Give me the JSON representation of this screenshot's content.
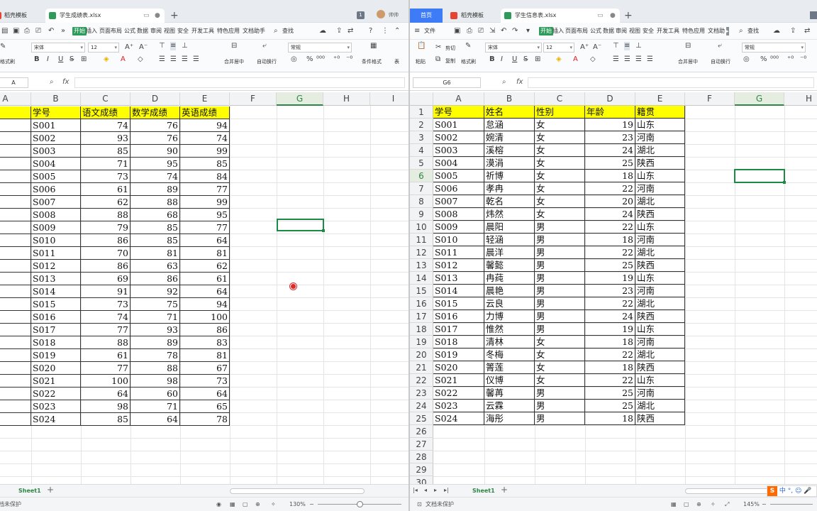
{
  "left": {
    "tabs": [
      {
        "label": "稻壳模板",
        "active": false
      },
      {
        "label": "学生成绩表.xlsx",
        "active": true
      }
    ],
    "tab_count": "1",
    "user": "帅帅",
    "menu": [
      "开始",
      "插入",
      "页面布局",
      "公式",
      "数据",
      "审阅",
      "视图",
      "安全",
      "开发工具",
      "特色应用",
      "文档助手"
    ],
    "search": "查找",
    "ribbon": {
      "font": "宋体",
      "size": "12",
      "number_format": "常规",
      "format_painter": "格式刷",
      "merge": "合并居中",
      "wrap": "自动换行",
      "conditional": "条件格式",
      "table": "表"
    },
    "name_box": "A",
    "fx": "fx",
    "col_headers": [
      "A",
      "B",
      "C",
      "D",
      "E",
      "F",
      "G",
      "H",
      "I"
    ],
    "selected_col": "G",
    "header_row": [
      "学号",
      "语文成绩",
      "数学成绩",
      "英语成绩"
    ],
    "rows": [
      [
        "S001",
        74,
        76,
        94
      ],
      [
        "S002",
        93,
        76,
        74
      ],
      [
        "S003",
        85,
        90,
        99
      ],
      [
        "S004",
        71,
        95,
        85
      ],
      [
        "S005",
        73,
        74,
        84
      ],
      [
        "S006",
        61,
        89,
        77
      ],
      [
        "S007",
        62,
        88,
        99
      ],
      [
        "S008",
        88,
        68,
        95
      ],
      [
        "S009",
        79,
        85,
        77
      ],
      [
        "S010",
        86,
        85,
        64
      ],
      [
        "S011",
        70,
        81,
        81
      ],
      [
        "S012",
        86,
        63,
        62
      ],
      [
        "S013",
        69,
        86,
        61
      ],
      [
        "S014",
        91,
        92,
        64
      ],
      [
        "S015",
        73,
        75,
        94
      ],
      [
        "S016",
        74,
        71,
        100
      ],
      [
        "S017",
        77,
        93,
        86
      ],
      [
        "S018",
        88,
        89,
        83
      ],
      [
        "S019",
        61,
        78,
        81
      ],
      [
        "S020",
        77,
        88,
        67
      ],
      [
        "S021",
        100,
        98,
        73
      ],
      [
        "S022",
        64,
        60,
        64
      ],
      [
        "S023",
        98,
        71,
        65
      ],
      [
        "S024",
        85,
        64,
        78
      ]
    ],
    "sheet": "Sheet1",
    "status": "档未保护",
    "zoom": "130%"
  },
  "right": {
    "home": "首页",
    "tabs": [
      {
        "label": "稻壳模板",
        "active": false
      },
      {
        "label": "学生信息表.xlsx",
        "active": true
      }
    ],
    "file_menu": "文件",
    "menu": [
      "开始",
      "插入",
      "页面布局",
      "公式",
      "数据",
      "审阅",
      "视图",
      "安全",
      "开发工具",
      "特色应用",
      "文档助"
    ],
    "search": "查找",
    "ribbon": {
      "paste": "粘贴",
      "cut": "剪切",
      "copy": "复制",
      "format_painter": "格式刷",
      "font": "宋体",
      "size": "12",
      "number_format": "常规",
      "merge": "合并居中",
      "wrap": "自动换行",
      "conditional": "条件格式"
    },
    "name_box": "G6",
    "fx": "fx",
    "col_headers": [
      "A",
      "B",
      "C",
      "D",
      "E",
      "F",
      "G",
      "H"
    ],
    "selected_col": "G",
    "selected_row": 6,
    "row_numbers": [
      1,
      2,
      3,
      4,
      5,
      6,
      7,
      8,
      9,
      10,
      11,
      12,
      13,
      14,
      15,
      16,
      17,
      18,
      19,
      20,
      21,
      22,
      23,
      24,
      25,
      26,
      27,
      28,
      29,
      30
    ],
    "header_row": [
      "学号",
      "姓名",
      "性别",
      "年龄",
      "籍贯"
    ],
    "rows": [
      [
        "S001",
        "怠涵",
        "女",
        19,
        "山东"
      ],
      [
        "S002",
        "婉清",
        "女",
        23,
        "河南"
      ],
      [
        "S003",
        "溪榕",
        "女",
        24,
        "湖北"
      ],
      [
        "S004",
        "漠涓",
        "女",
        25,
        "陕西"
      ],
      [
        "S005",
        "祈博",
        "女",
        18,
        "山东"
      ],
      [
        "S006",
        "孝冉",
        "女",
        22,
        "河南"
      ],
      [
        "S007",
        "乾名",
        "女",
        20,
        "湖北"
      ],
      [
        "S008",
        "炜然",
        "女",
        24,
        "陕西"
      ],
      [
        "S009",
        "晨阳",
        "男",
        22,
        "山东"
      ],
      [
        "S010",
        "轻涵",
        "男",
        18,
        "河南"
      ],
      [
        "S011",
        "晨洋",
        "男",
        22,
        "湖北"
      ],
      [
        "S012",
        "馨懿",
        "男",
        25,
        "陕西"
      ],
      [
        "S013",
        "冉莼",
        "男",
        19,
        "山东"
      ],
      [
        "S014",
        "晨艳",
        "男",
        23,
        "河南"
      ],
      [
        "S015",
        "云良",
        "男",
        22,
        "湖北"
      ],
      [
        "S016",
        "力博",
        "男",
        24,
        "陕西"
      ],
      [
        "S017",
        "惟然",
        "男",
        19,
        "山东"
      ],
      [
        "S018",
        "清林",
        "女",
        18,
        "河南"
      ],
      [
        "S019",
        "冬梅",
        "女",
        22,
        "湖北"
      ],
      [
        "S020",
        "箐莲",
        "女",
        18,
        "陕西"
      ],
      [
        "S021",
        "仪博",
        "女",
        22,
        "山东"
      ],
      [
        "S022",
        "馨苒",
        "男",
        25,
        "河南"
      ],
      [
        "S023",
        "云霖",
        "男",
        25,
        "湖北"
      ],
      [
        "S024",
        "海彤",
        "男",
        18,
        "陕西"
      ]
    ],
    "sheet": "Sheet1",
    "status": "文档未保护",
    "zoom": "145%",
    "ime": [
      "中",
      "°,",
      "☺",
      "🎤"
    ]
  },
  "colors": {
    "accent_green": "#2f8548",
    "header_fill": "#ffff00",
    "wps_blue": "#3d7cf6",
    "cursor_red": "#e02828"
  }
}
